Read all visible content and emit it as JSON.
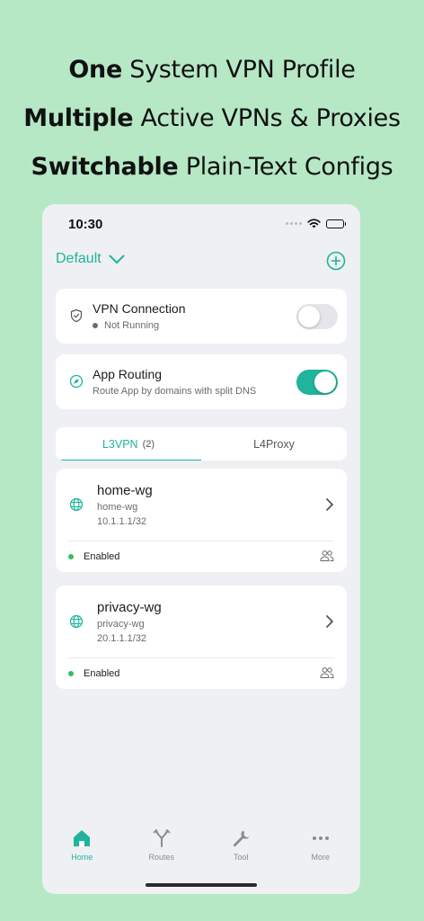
{
  "headlines": [
    {
      "bold": "One",
      "rest": " System VPN Profile"
    },
    {
      "bold": "Multiple",
      "rest": " Active VPNs & Proxies"
    },
    {
      "bold": "Switchable",
      "rest": " Plain-Text Configs"
    }
  ],
  "status_bar": {
    "time": "10:30"
  },
  "profile": {
    "name": "Default"
  },
  "vpn_connection": {
    "title": "VPN Connection",
    "status": "Not Running",
    "enabled": false
  },
  "app_routing": {
    "title": "App Routing",
    "subtitle": "Route App by domains with split DNS",
    "enabled": true
  },
  "tabs": {
    "l3vpn_label": "L3VPN",
    "l3vpn_count": "(2)",
    "l4proxy_label": "L4Proxy"
  },
  "vpns": [
    {
      "name": "home-wg",
      "interface": "home-wg",
      "address": "10.1.1.1/32",
      "status": "Enabled"
    },
    {
      "name": "privacy-wg",
      "interface": "privacy-wg",
      "address": "20.1.1.1/32",
      "status": "Enabled"
    }
  ],
  "tabbar": {
    "home": "Home",
    "routes": "Routes",
    "tool": "Tool",
    "more": "More"
  },
  "colors": {
    "accent": "#1fb49b",
    "background": "#b6e8c6",
    "enabled_dot": "#2fc25c"
  }
}
